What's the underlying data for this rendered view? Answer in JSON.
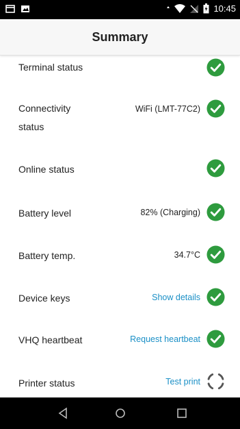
{
  "status_bar": {
    "time": "10:45",
    "left_icons": [
      "window-icon",
      "image-icon"
    ],
    "right_icons": [
      "data-arrows-icon",
      "wifi-icon",
      "signal-icon",
      "battery-icon"
    ]
  },
  "header": {
    "title": "Summary"
  },
  "rows": [
    {
      "label": "Terminal status",
      "value": "",
      "status": "ok"
    },
    {
      "label": "Connectivity status",
      "value": "WiFi (LMT-77C2)",
      "status": "ok"
    },
    {
      "label": "Online status",
      "value": "",
      "status": "ok"
    },
    {
      "label": "Battery level",
      "value": "82% (Charging)",
      "status": "ok"
    },
    {
      "label": "Battery temp.",
      "value": "34.7°C",
      "status": "ok"
    },
    {
      "label": "Device keys",
      "value": "Show details",
      "status": "ok",
      "link": true
    },
    {
      "label": "VHQ heartbeat",
      "value": "Request heartbeat",
      "status": "ok",
      "link": true
    },
    {
      "label": "Printer status",
      "value": "Test print",
      "status": "loading",
      "link": true
    }
  ],
  "colors": {
    "ok": "#2e9b3e",
    "link": "#1a8fc6"
  },
  "nav_bar": {
    "icons": [
      "back-icon",
      "home-icon",
      "recents-icon"
    ]
  }
}
